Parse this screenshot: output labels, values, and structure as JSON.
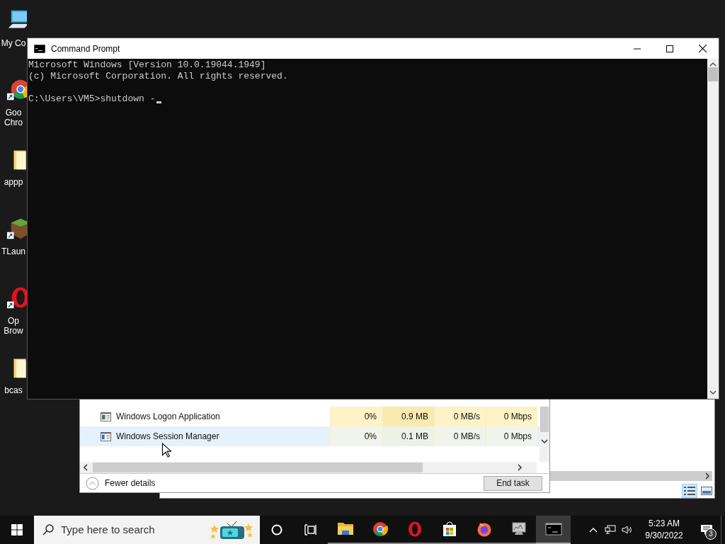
{
  "desktop_icons": [
    {
      "kind": "computer",
      "lines": [
        "My Co"
      ]
    },
    {
      "kind": "chrome",
      "lines": [
        "Goo",
        "Chro"
      ]
    },
    {
      "kind": "folder",
      "lines": [
        "appp"
      ]
    },
    {
      "kind": "grass",
      "lines": [
        "TLaun"
      ]
    },
    {
      "kind": "opera",
      "lines": [
        "Op",
        "Brow"
      ]
    },
    {
      "kind": "folder",
      "lines": [
        "bcas"
      ]
    }
  ],
  "task_manager": {
    "rows": [
      {
        "name": "Windows Logon Application",
        "cpu": "0%",
        "memory": "0.9 MB",
        "disk": "0 MB/s",
        "network": "0 Mbps",
        "selected": false
      },
      {
        "name": "Windows Session Manager",
        "cpu": "0%",
        "memory": "0.1 MB",
        "disk": "0 MB/s",
        "network": "0 Mbps",
        "selected": true
      }
    ],
    "fewer_details": "Fewer details",
    "end_task": "End task"
  },
  "command_prompt": {
    "title": "Command Prompt",
    "lines": [
      "Microsoft Windows [Version 10.0.19044.1949]",
      "(c) Microsoft Corporation. All rights reserved."
    ],
    "prompt": "C:\\Users\\VM5>shutdown -"
  },
  "taskbar": {
    "search_placeholder": "Type here to search",
    "apps": [
      {
        "kind": "explorer",
        "selected": false
      },
      {
        "kind": "chrome",
        "selected": false
      },
      {
        "kind": "opera",
        "selected": false
      },
      {
        "kind": "store",
        "selected": false
      },
      {
        "kind": "firefox",
        "selected": false
      },
      {
        "kind": "monitor",
        "selected": false
      },
      {
        "kind": "cmd",
        "selected": true
      }
    ],
    "time": "5:23 AM",
    "date": "9/30/2022",
    "notifications": "3"
  }
}
